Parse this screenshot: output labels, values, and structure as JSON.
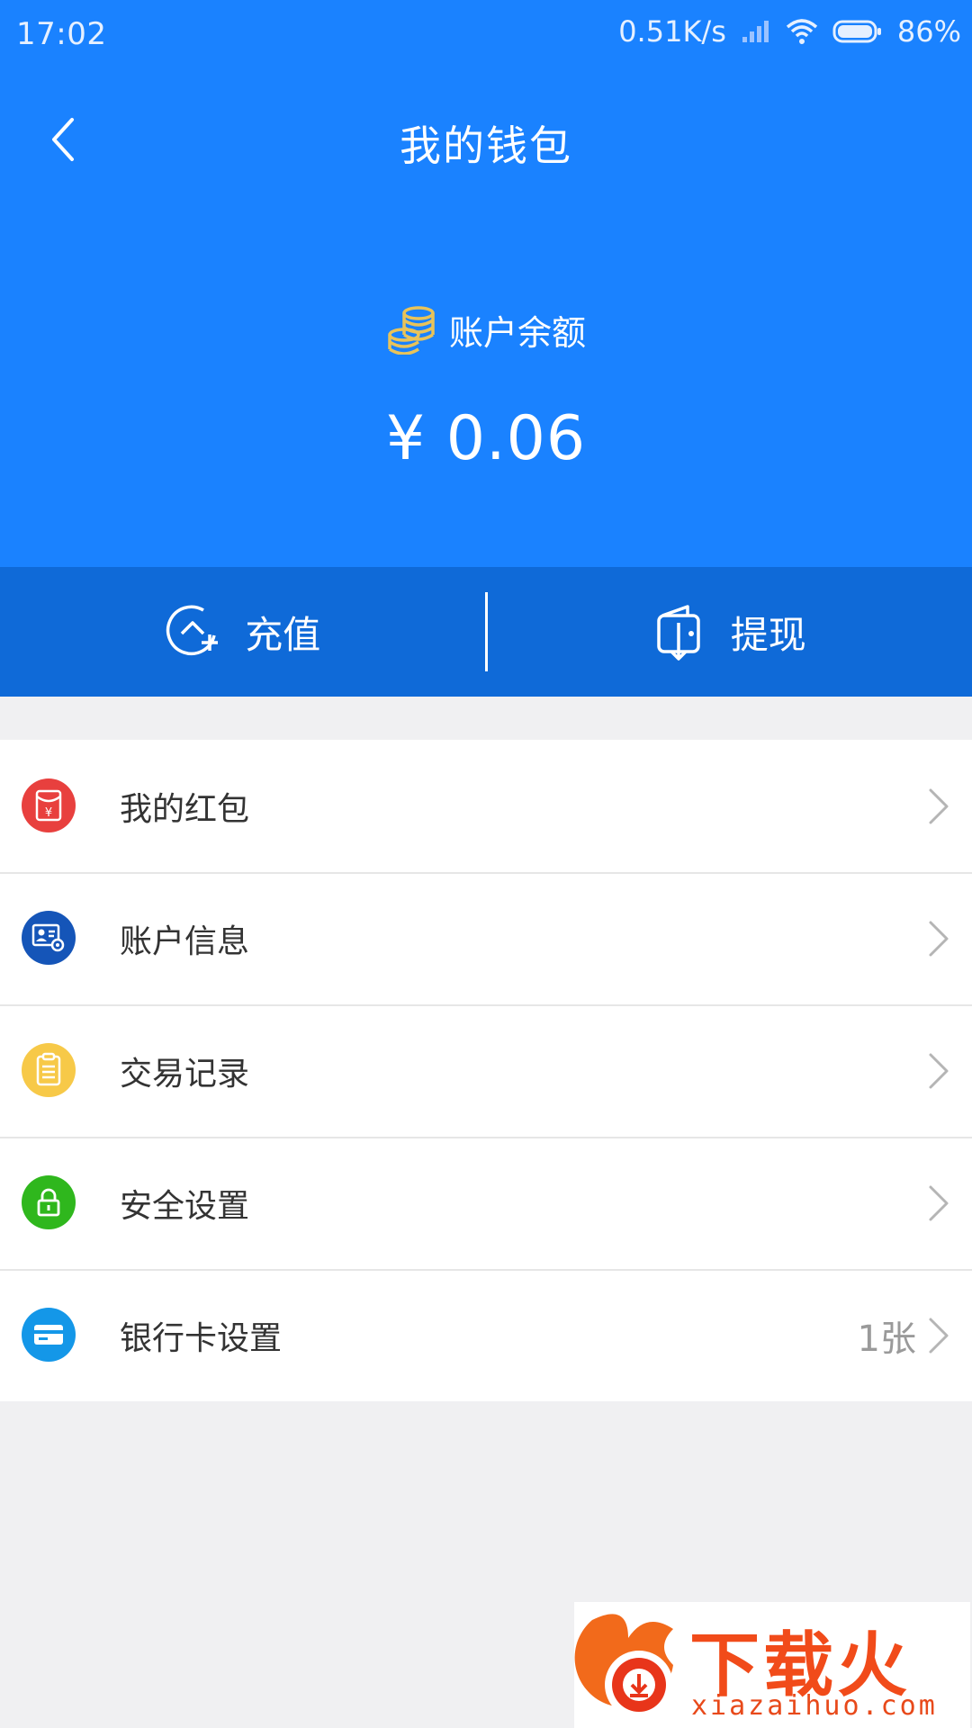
{
  "status_bar": {
    "time": "17:02",
    "network_speed": "0.51K/s",
    "battery": "86%"
  },
  "nav": {
    "title": "我的钱包"
  },
  "balance": {
    "label": "账户余额",
    "amount": "¥ 0.06"
  },
  "actions": {
    "recharge": "充值",
    "withdraw": "提现"
  },
  "menu": {
    "items": [
      {
        "label": "我的红包",
        "icon": "red-envelope-icon",
        "color": "#e8403e",
        "extra": ""
      },
      {
        "label": "账户信息",
        "icon": "account-info-icon",
        "color": "#1555b8",
        "extra": ""
      },
      {
        "label": "交易记录",
        "icon": "transaction-record-icon",
        "color": "#f7c948",
        "extra": ""
      },
      {
        "label": "安全设置",
        "icon": "lock-icon",
        "color": "#2fb71d",
        "extra": ""
      },
      {
        "label": "银行卡设置",
        "icon": "bank-card-icon",
        "color": "#1497e8",
        "extra": "1张"
      }
    ]
  },
  "watermark": {
    "text": "下载火",
    "domain": "xiazaihuo.com"
  },
  "colors": {
    "header_blue": "#1a82ff",
    "action_bar_blue": "#0f6ad8",
    "coin_gold": "#e8c35a"
  }
}
